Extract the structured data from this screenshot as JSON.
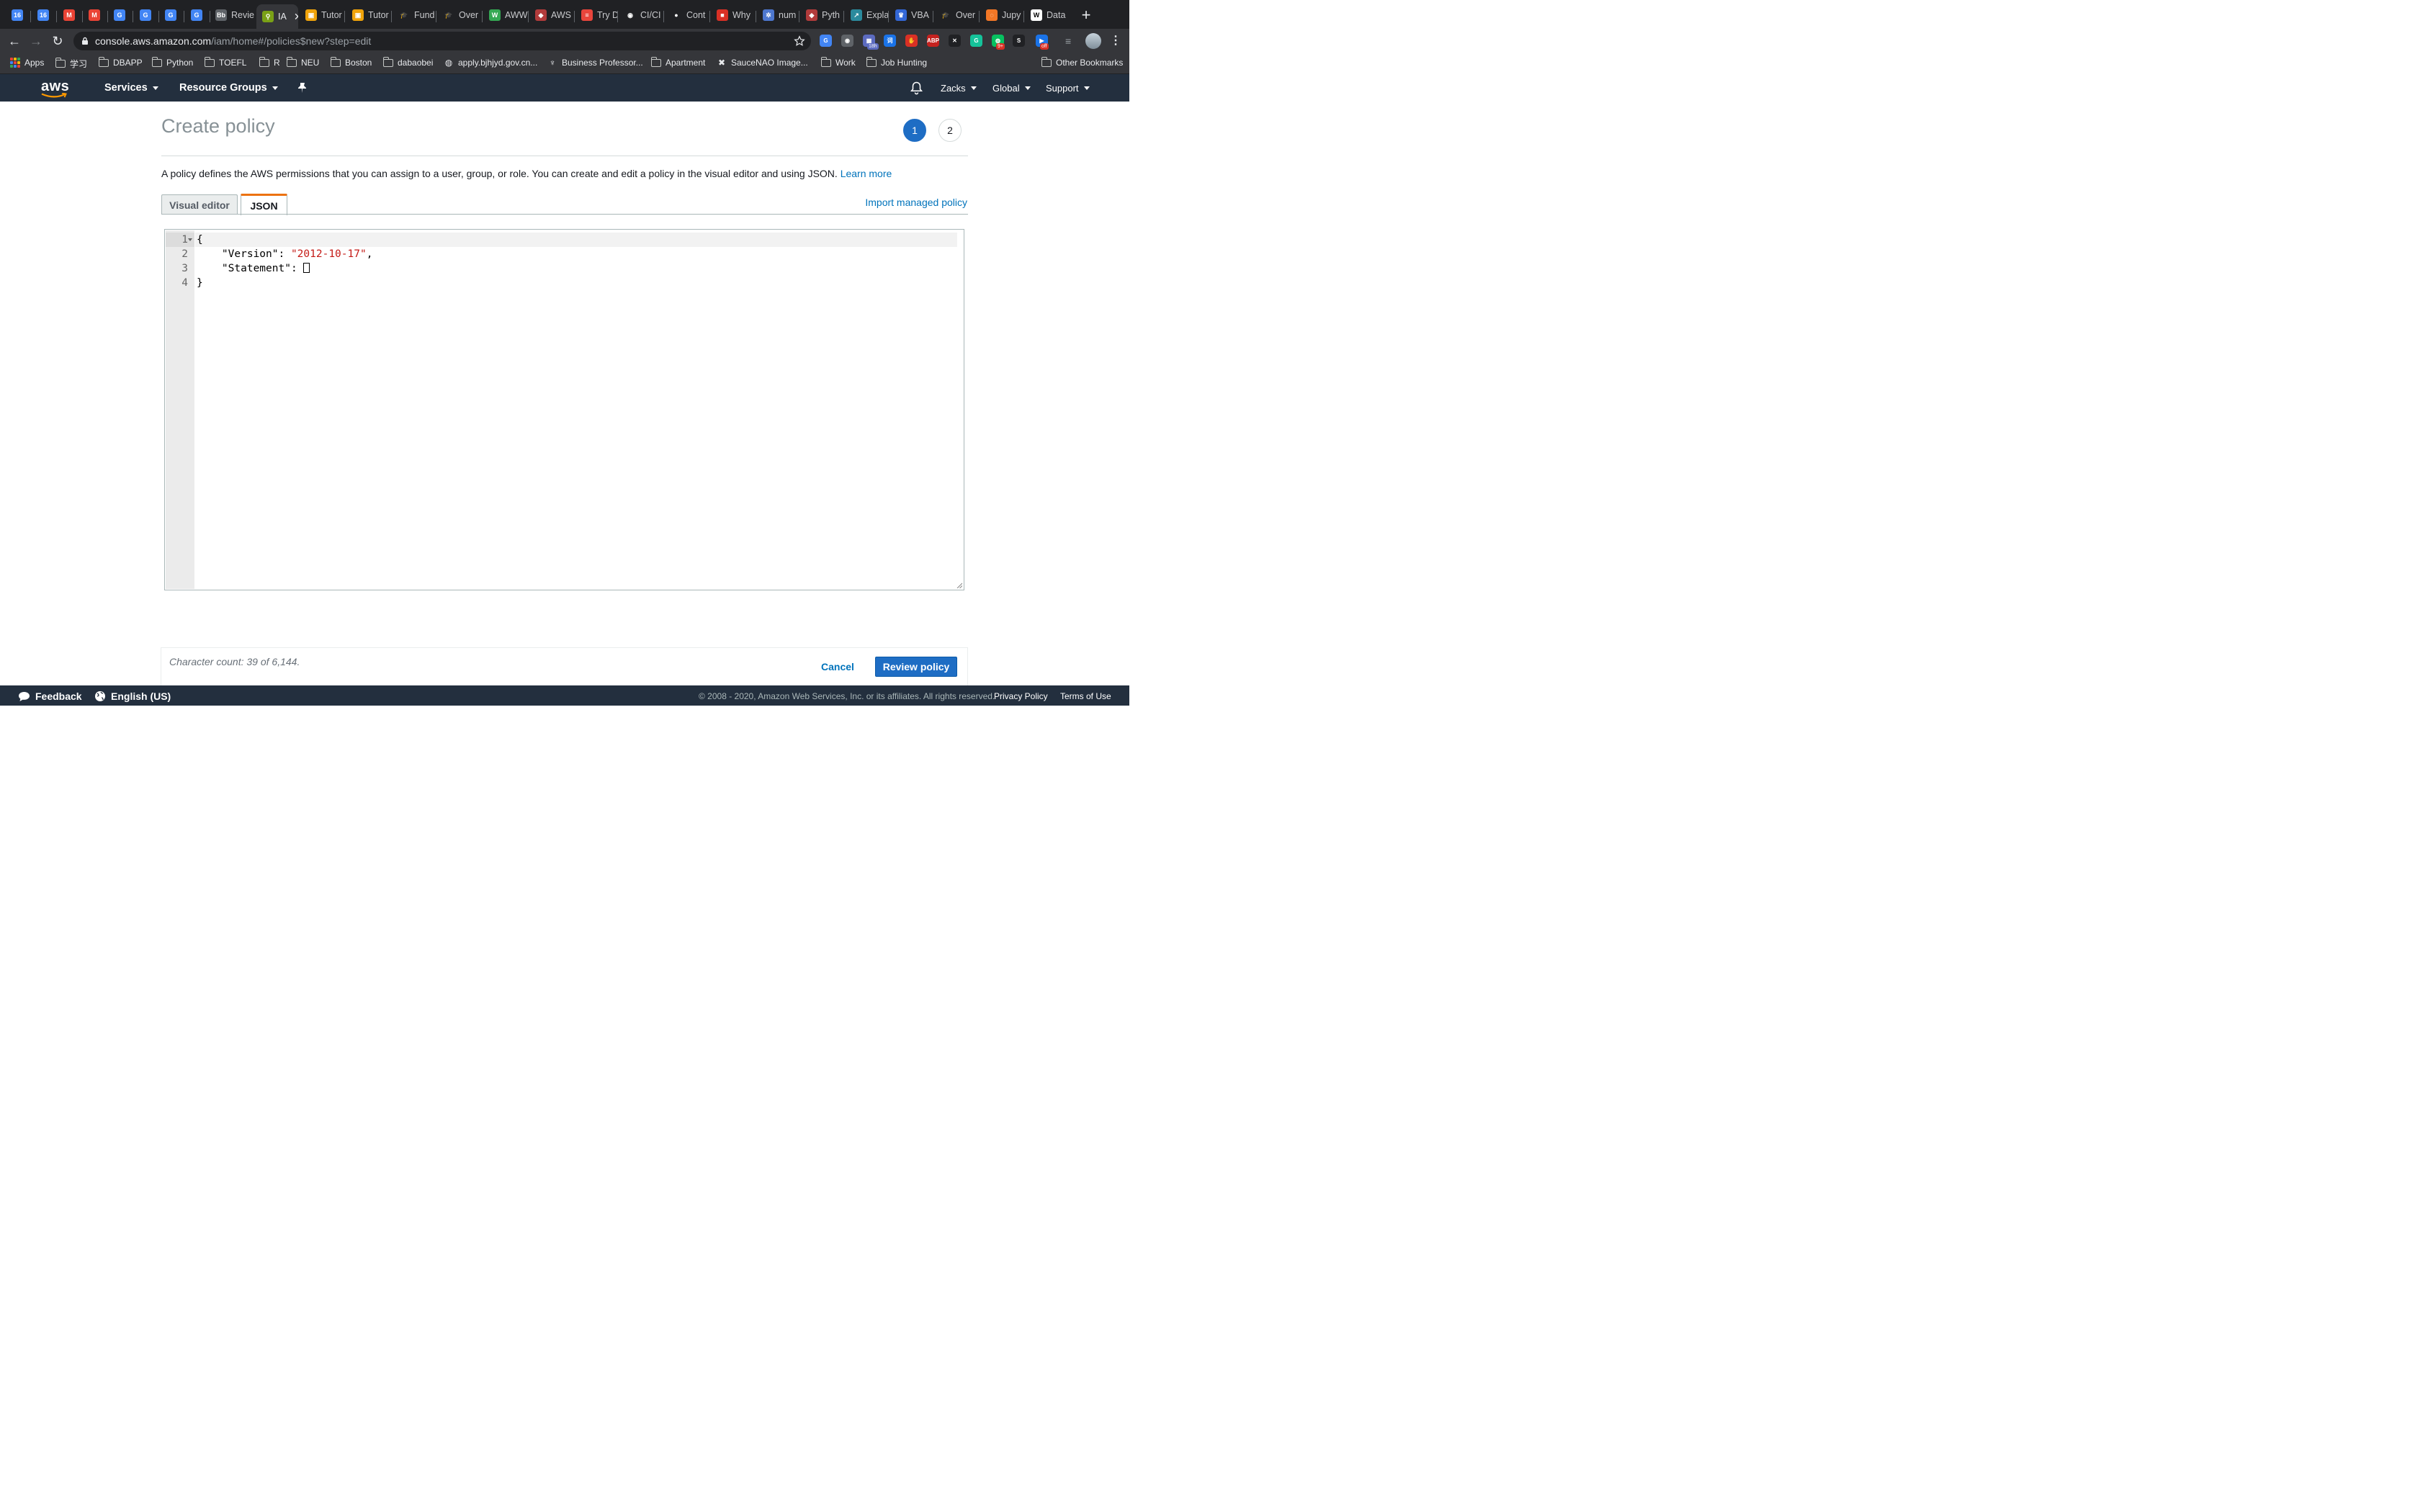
{
  "browser": {
    "tabs": [
      {
        "label": "",
        "icon": "calendar-icon",
        "color": "#4285f4",
        "glyph": "16"
      },
      {
        "label": "",
        "icon": "calendar-icon",
        "color": "#4285f4",
        "glyph": "16"
      },
      {
        "label": "",
        "icon": "gmail-icon",
        "color": "#ea4335",
        "glyph": "M"
      },
      {
        "label": "",
        "icon": "gmail-icon",
        "color": "#ea4335",
        "glyph": "M"
      },
      {
        "label": "",
        "icon": "translate-icon",
        "color": "#4285f4",
        "glyph": "G"
      },
      {
        "label": "",
        "icon": "translate-icon",
        "color": "#4285f4",
        "glyph": "G"
      },
      {
        "label": "",
        "icon": "translate-icon",
        "color": "#4285f4",
        "glyph": "G"
      },
      {
        "label": "",
        "icon": "translate-icon",
        "color": "#4285f4",
        "glyph": "G"
      },
      {
        "label": "Revie",
        "icon": "bb-icon",
        "color": "#5f6368",
        "glyph": "Bb"
      },
      {
        "label": "IA",
        "icon": "iam-icon",
        "color": "#7aa116",
        "glyph": "⚲",
        "active": true
      },
      {
        "label": "Tutor",
        "icon": "box-icon",
        "color": "#f0a30a",
        "glyph": "▣"
      },
      {
        "label": "Tutor",
        "icon": "box-icon",
        "color": "#f0a30a",
        "glyph": "▣"
      },
      {
        "label": "Fund",
        "icon": "graduation-cap-icon",
        "color": "#202124",
        "glyph": "🎓"
      },
      {
        "label": "Over",
        "icon": "graduation-cap-icon",
        "color": "#202124",
        "glyph": "🎓"
      },
      {
        "label": "AWW",
        "icon": "w-icon",
        "color": "#34a853",
        "glyph": "W"
      },
      {
        "label": "AWS",
        "icon": "dragon-icon",
        "color": "#b23b3b",
        "glyph": "◆"
      },
      {
        "label": "Try D",
        "icon": "stack-icon",
        "color": "#e8453c",
        "glyph": "≡"
      },
      {
        "label": "CI/CI",
        "icon": "circle-icon",
        "color": "#202124",
        "glyph": "◉"
      },
      {
        "label": "Cont",
        "icon": "github-icon",
        "color": "#202124",
        "glyph": "●"
      },
      {
        "label": "Why",
        "icon": "flag-icon",
        "color": "#d93025",
        "glyph": "■"
      },
      {
        "label": "num",
        "icon": "numpy-icon",
        "color": "#4d77cf",
        "glyph": "✲"
      },
      {
        "label": "Pyth",
        "icon": "dragon-icon",
        "color": "#b23b3b",
        "glyph": "◆"
      },
      {
        "label": "Expla",
        "icon": "chart-icon",
        "color": "#2b8a9d",
        "glyph": "↗"
      },
      {
        "label": "VBA",
        "icon": "excel-icon",
        "color": "#3367d6",
        "glyph": "♛"
      },
      {
        "label": "Over",
        "icon": "graduation-cap-icon",
        "color": "#202124",
        "glyph": "🎓"
      },
      {
        "label": "Jupy",
        "icon": "jupyter-icon",
        "color": "#f37726",
        "glyph": "◌"
      },
      {
        "label": "Data",
        "icon": "wikipedia-icon",
        "color": "#ffffff",
        "glyph": "W"
      }
    ],
    "url_host": "console.aws.amazon.com",
    "url_path": "/iam/home#/policies$new?step=edit"
  },
  "bookmarks": [
    {
      "label": "Apps",
      "icon": "apps-grid-icon"
    },
    {
      "label": "学习",
      "icon": "folder-icon"
    },
    {
      "label": "DBAPP",
      "icon": "folder-icon"
    },
    {
      "label": "Python",
      "icon": "folder-icon"
    },
    {
      "label": "TOEFL",
      "icon": "folder-icon"
    },
    {
      "label": "R",
      "icon": "folder-icon"
    },
    {
      "label": "NEU",
      "icon": "folder-icon"
    },
    {
      "label": "Boston",
      "icon": "folder-icon"
    },
    {
      "label": "dabaobei",
      "icon": "folder-icon"
    },
    {
      "label": "apply.bjhjyd.gov.cn...",
      "icon": "globe-icon"
    },
    {
      "label": "Business Professor...",
      "icon": "bulb-icon"
    },
    {
      "label": "Apartment",
      "icon": "folder-icon"
    },
    {
      "label": "SauceNAO Image...",
      "icon": "saucenao-icon"
    },
    {
      "label": "Work",
      "icon": "folder-icon"
    },
    {
      "label": "Job Hunting",
      "icon": "folder-icon"
    },
    {
      "label": "Other Bookmarks",
      "icon": "folder-icon"
    }
  ],
  "extensions": [
    {
      "name": "translate-ext-icon",
      "color": "#4285f4",
      "glyph": "G"
    },
    {
      "name": "location-ext-icon",
      "color": "#5f6368",
      "glyph": "◉"
    },
    {
      "name": "calendar-ext-icon",
      "color": "#5c6bc0",
      "glyph": "▦",
      "badge": "18h"
    },
    {
      "name": "dictionary-ext-icon",
      "color": "#1a73e8",
      "glyph": "词"
    },
    {
      "name": "stop-ext-icon",
      "color": "#d93025",
      "glyph": "✋"
    },
    {
      "name": "adblock-ext-icon",
      "color": "#c5221f",
      "glyph": "ABP"
    },
    {
      "name": "x-ext-icon",
      "color": "#202124",
      "glyph": "✕"
    },
    {
      "name": "grammarly-ext-icon",
      "color": "#15c39a",
      "glyph": "G"
    },
    {
      "name": "wechat-ext-icon",
      "color": "#07c160",
      "glyph": "◍",
      "badge": "9+"
    },
    {
      "name": "shot-ext-icon",
      "color": "#202124",
      "glyph": "S"
    },
    {
      "name": "video-ext-icon",
      "color": "#1a73e8",
      "glyph": "▶",
      "badge": "off"
    }
  ],
  "aws_nav": {
    "logo": "aws",
    "services": "Services",
    "resource_groups": "Resource Groups",
    "user": "Zacks",
    "region": "Global",
    "support": "Support"
  },
  "page": {
    "title": "Create policy",
    "steps": [
      "1",
      "2"
    ],
    "description": "A policy defines the AWS permissions that you can assign to a user, group, or role. You can create and edit a policy in the visual editor and using JSON.",
    "learn_more": "Learn more",
    "tabs": {
      "visual": "Visual editor",
      "json": "JSON"
    },
    "import_link": "Import managed policy"
  },
  "editor": {
    "line_numbers": [
      "1",
      "2",
      "3",
      "4"
    ],
    "version_key": "\"Version\": ",
    "version_value": "\"2012-10-17\"",
    "statement_key": "\"Statement\": ",
    "open_brace": "{",
    "close_brace": "}",
    "comma": ","
  },
  "footer_actions": {
    "char_count": "Character count: 39 of 6,144.",
    "cancel": "Cancel",
    "review": "Review policy"
  },
  "footer": {
    "feedback": "Feedback",
    "language": "English (US)",
    "copyright": "© 2008 - 2020, Amazon Web Services, Inc. or its affiliates. All rights reserved.",
    "privacy": "Privacy Policy",
    "terms": "Terms of Use"
  }
}
